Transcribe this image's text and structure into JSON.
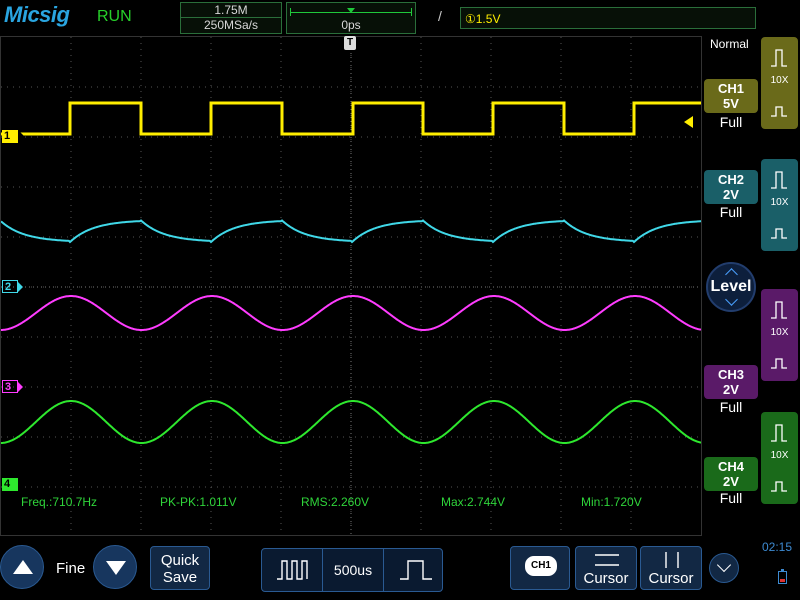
{
  "header": {
    "brand": "Micsig",
    "run_state": "RUN",
    "memory_depth": "1.75M",
    "sample_rate": "250MSa/s",
    "time_offset": "0ps",
    "trigger_edge_symbol": "/",
    "trigger_level": "①1.5V",
    "acquire_mode": "Normal"
  },
  "channels": [
    {
      "id": "1",
      "label": "CH1",
      "scale": "5V",
      "coupling": "Full",
      "probe": "10X",
      "color": "#ffee00",
      "tile_color": "#77771f",
      "label_bg": "#77771f"
    },
    {
      "id": "2",
      "label": "CH2",
      "scale": "2V",
      "coupling": "Full",
      "probe": "10X",
      "color": "#40d8e8",
      "tile_color": "#1f6f78",
      "label_bg": "#1f6f78"
    },
    {
      "id": "3",
      "label": "CH3",
      "scale": "2V",
      "coupling": "Full",
      "probe": "10X",
      "color": "#ff3cff",
      "tile_color": "#6f1f78",
      "label_bg": "#6f1f78"
    },
    {
      "id": "4",
      "label": "CH4",
      "scale": "2V",
      "coupling": "Full",
      "probe": "10X",
      "color": "#2ee82e",
      "tile_color": "#1f7a1f",
      "label_bg": "#1f7a1f"
    }
  ],
  "measurements": {
    "freq": "Freq.:710.7Hz",
    "pkpk": "PK-PK:1.011V",
    "rms": "RMS:2.260V",
    "max": "Max:2.744V",
    "min": "Min:1.720V"
  },
  "side": {
    "level_label": "Level"
  },
  "bottom": {
    "fine_label": "Fine",
    "quick_save_line1": "Quick",
    "quick_save_line2": "Save",
    "timebase": "500us",
    "ch_badge": "CH1",
    "cursor_a": "Cursor",
    "cursor_b": "Cursor",
    "clock": "02:15"
  },
  "icons": [
    "up-arrow-icon",
    "down-arrow-icon",
    "pulse-icon",
    "chevron-down-icon",
    "battery-icon",
    "level-knob-icon"
  ]
}
